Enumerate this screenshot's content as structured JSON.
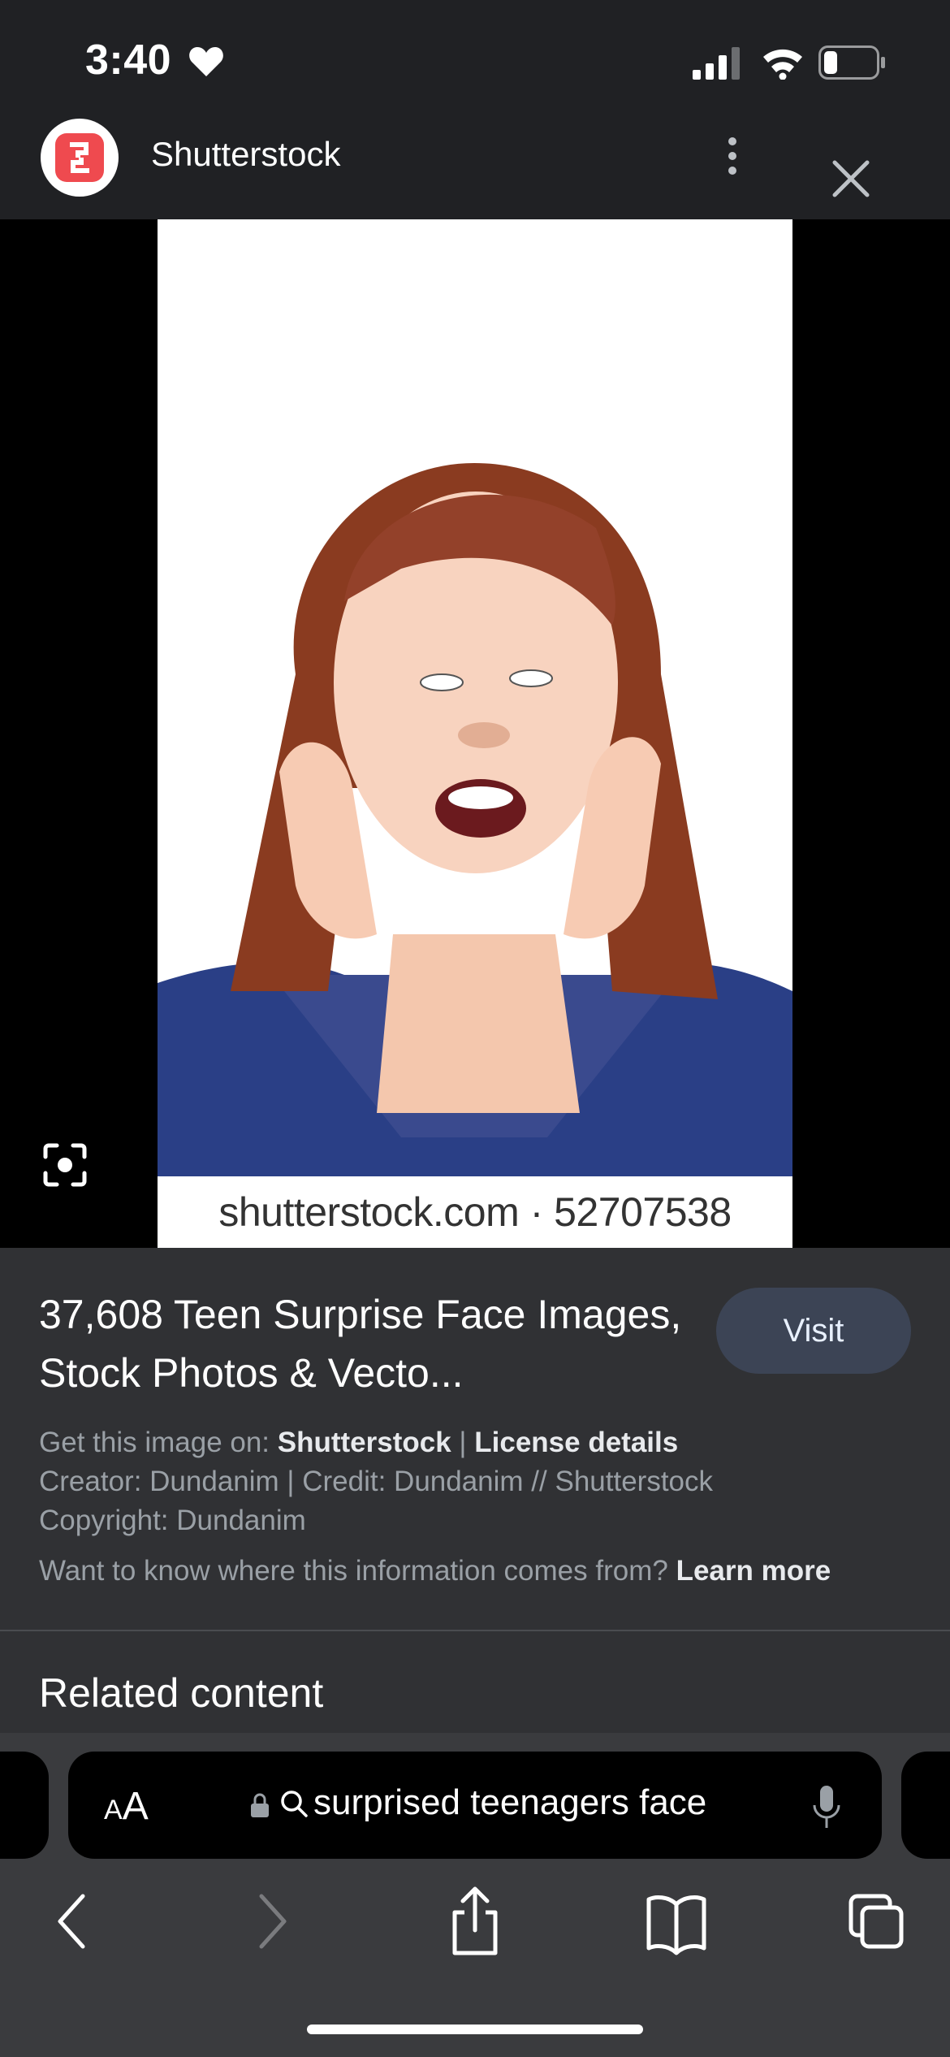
{
  "status_bar": {
    "time": "3:40"
  },
  "header": {
    "site_name": "Shutterstock"
  },
  "image": {
    "watermark": "shutterstock.com · 52707538"
  },
  "result": {
    "title": "37,608 Teen Surprise Face Images, Stock Photos & Vecto...",
    "visit_label": "Visit",
    "get_on_prefix": "Get this image on: ",
    "source_link": "Shutterstock",
    "separator": " | ",
    "license_link": "License details",
    "creator_line": "Creator: Dundanim | Credit: Dundanim // Shutterstock",
    "copyright_line": "Copyright: Dundanim",
    "info_question": "Want to know where this information comes from? ",
    "learn_more": "Learn more"
  },
  "related": {
    "heading": "Related content"
  },
  "browser": {
    "text_size_big": "A",
    "text_size_small": "A",
    "search_query": "surprised teenagers face"
  },
  "icons": {
    "heart": "heart-icon",
    "signal": "cellular-signal-icon",
    "wifi": "wifi-icon",
    "battery": "battery-icon",
    "kebab": "more-vert-icon",
    "close": "close-icon",
    "lens": "google-lens-icon",
    "lock": "lock-icon",
    "search": "search-icon",
    "mic": "microphone-icon",
    "back": "chevron-left-icon",
    "forward": "chevron-right-icon",
    "share": "share-icon",
    "bookmarks": "book-icon",
    "tabs": "tabs-icon"
  },
  "colors": {
    "background": "#202124",
    "panel": "#303134",
    "visit_button": "#3c4455",
    "logo_red": "#ef4a4f",
    "muted_text": "#9aa0a6"
  }
}
